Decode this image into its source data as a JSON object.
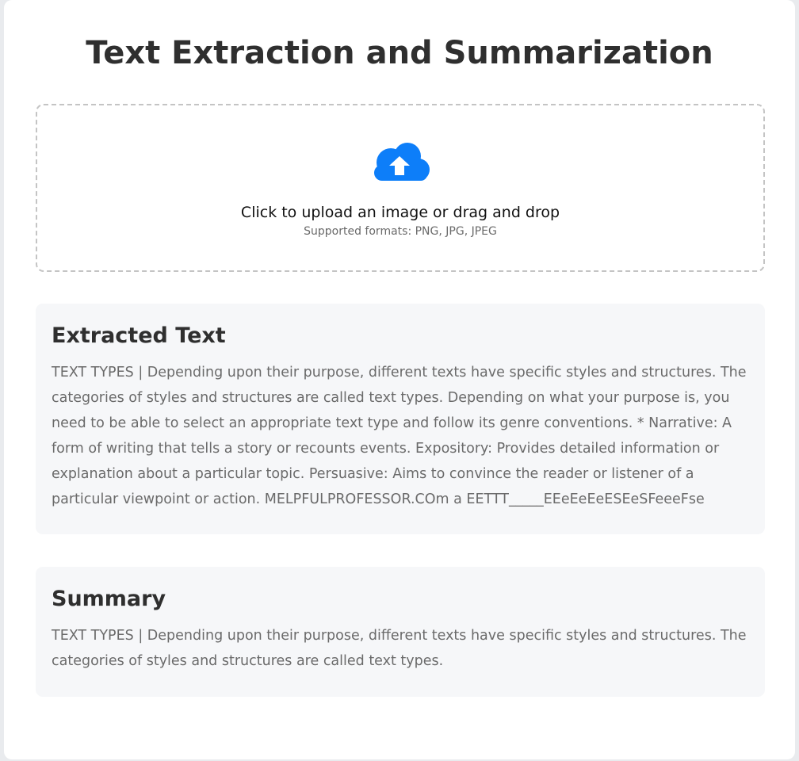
{
  "page": {
    "title": "Text Extraction and Summarization"
  },
  "upload": {
    "icon": "cloud-upload-icon",
    "icon_color": "#0d7ef9",
    "main_text": "Click to upload an image or drag and drop",
    "formats_text": "Supported formats: PNG, JPG, JPEG"
  },
  "extracted": {
    "heading": "Extracted Text",
    "body": "TEXT TYPES | Depending upon their purpose, different texts have specific styles and structures. The categories of styles and structures are called text types. Depending on what your purpose is, you need to be able to select an appropriate text type and follow its genre conventions. * Narrative: A form of writing that tells a story or recounts events. Expository: Provides detailed information or explanation about a particular topic. Persuasive: Aims to convince the reader or listener of a particular viewpoint or action. MELPFULPROFESSOR.COm a EETTT_____EEeEeEeESEeSFeeeFse"
  },
  "summary": {
    "heading": "Summary",
    "body": "TEXT TYPES | Depending upon their purpose, different texts have specific styles and structures. The categories of styles and structures are called text types."
  }
}
